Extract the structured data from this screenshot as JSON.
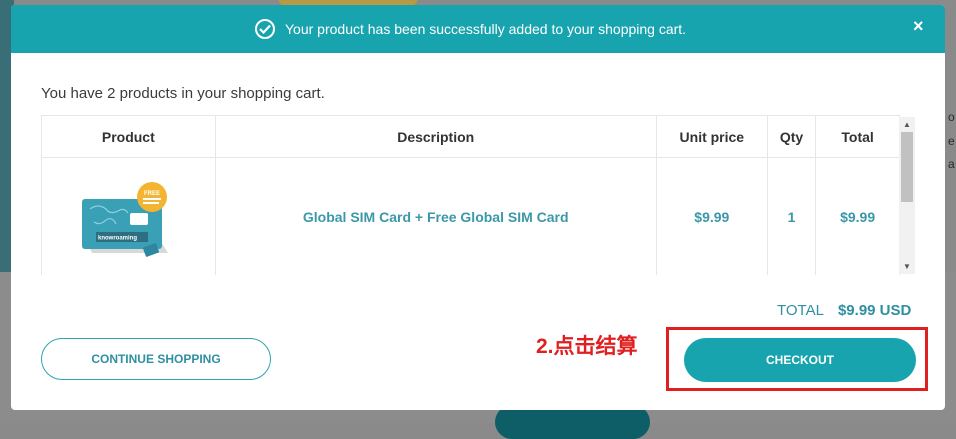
{
  "banner": {
    "message": "Your product has been successfully added to your shopping cart.",
    "close_label": "×"
  },
  "cart": {
    "summary": "You have 2 products in your shopping cart.",
    "columns": [
      "Product",
      "Description",
      "Unit price",
      "Qty",
      "Total"
    ],
    "rows": [
      {
        "description": "Global SIM Card + Free Global SIM Card",
        "unit_price": "$9.99",
        "qty": "1",
        "total": "$9.99",
        "image_badge": "FREE",
        "image_brand": "knowroaming"
      }
    ]
  },
  "totals": {
    "label": "TOTAL",
    "amount": "$9.99 USD"
  },
  "actions": {
    "continue_label": "CONTINUE SHOPPING",
    "checkout_label": "CHECKOUT"
  },
  "annotation": {
    "label": "2.点击结算"
  },
  "background": {
    "right_letters": [
      "o",
      "e",
      "a"
    ]
  },
  "colors": {
    "accent": "#17a4ae",
    "link": "#3b98a8",
    "annotation": "#e02020"
  }
}
